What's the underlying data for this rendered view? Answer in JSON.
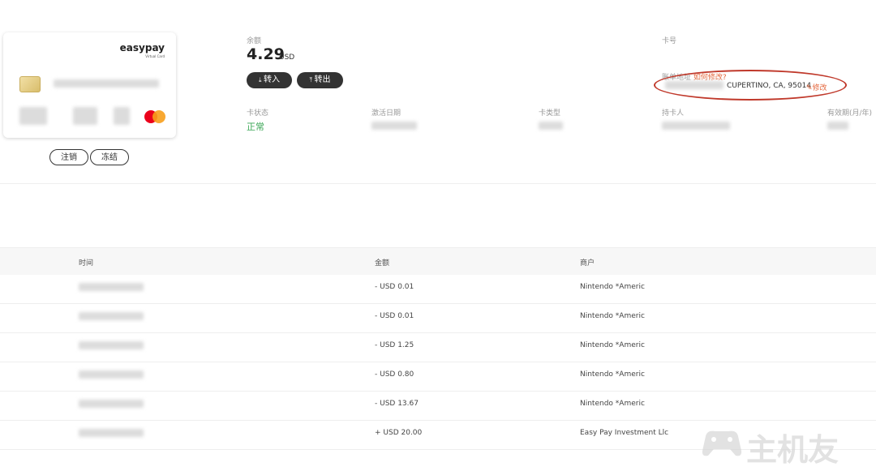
{
  "card": {
    "brand": "easypay",
    "subtitle": "Virtual Card",
    "buttons": {
      "cancel": "注销",
      "freeze": "冻结"
    }
  },
  "balance": {
    "label": "余额",
    "amount": "4.29",
    "currency": "USD",
    "deposit": "转入",
    "withdraw": "转出"
  },
  "card_number": {
    "label": "卡号"
  },
  "billing": {
    "label_prefix": "账单地址",
    "hint": "如何修改?",
    "address": "CUPERTINO, CA, 95014",
    "edit": "修改"
  },
  "details": {
    "status_label": "卡状态",
    "status_value": "正常",
    "open_date_label": "激活日期",
    "card_type_label": "卡类型",
    "holder_label": "持卡人",
    "expiry_label": "有效期(月/年)"
  },
  "table": {
    "headers": {
      "time": "时间",
      "amount": "金额",
      "merchant": "商户"
    },
    "rows": [
      {
        "amount": "- USD 0.01",
        "merchant": "Nintendo *Americ"
      },
      {
        "amount": "- USD 0.01",
        "merchant": "Nintendo *Americ"
      },
      {
        "amount": "- USD 1.25",
        "merchant": "Nintendo *Americ"
      },
      {
        "amount": "- USD 0.80",
        "merchant": "Nintendo *Americ"
      },
      {
        "amount": "- USD 13.67",
        "merchant": "Nintendo *Americ"
      },
      {
        "amount": "+ USD 20.00",
        "merchant": "Easy Pay Investment Llc"
      }
    ]
  },
  "watermark": "主机友",
  "colors": {
    "accent_green": "#3aa655",
    "edit_orange": "#e4673d",
    "highlight_ring": "#c0392b"
  }
}
